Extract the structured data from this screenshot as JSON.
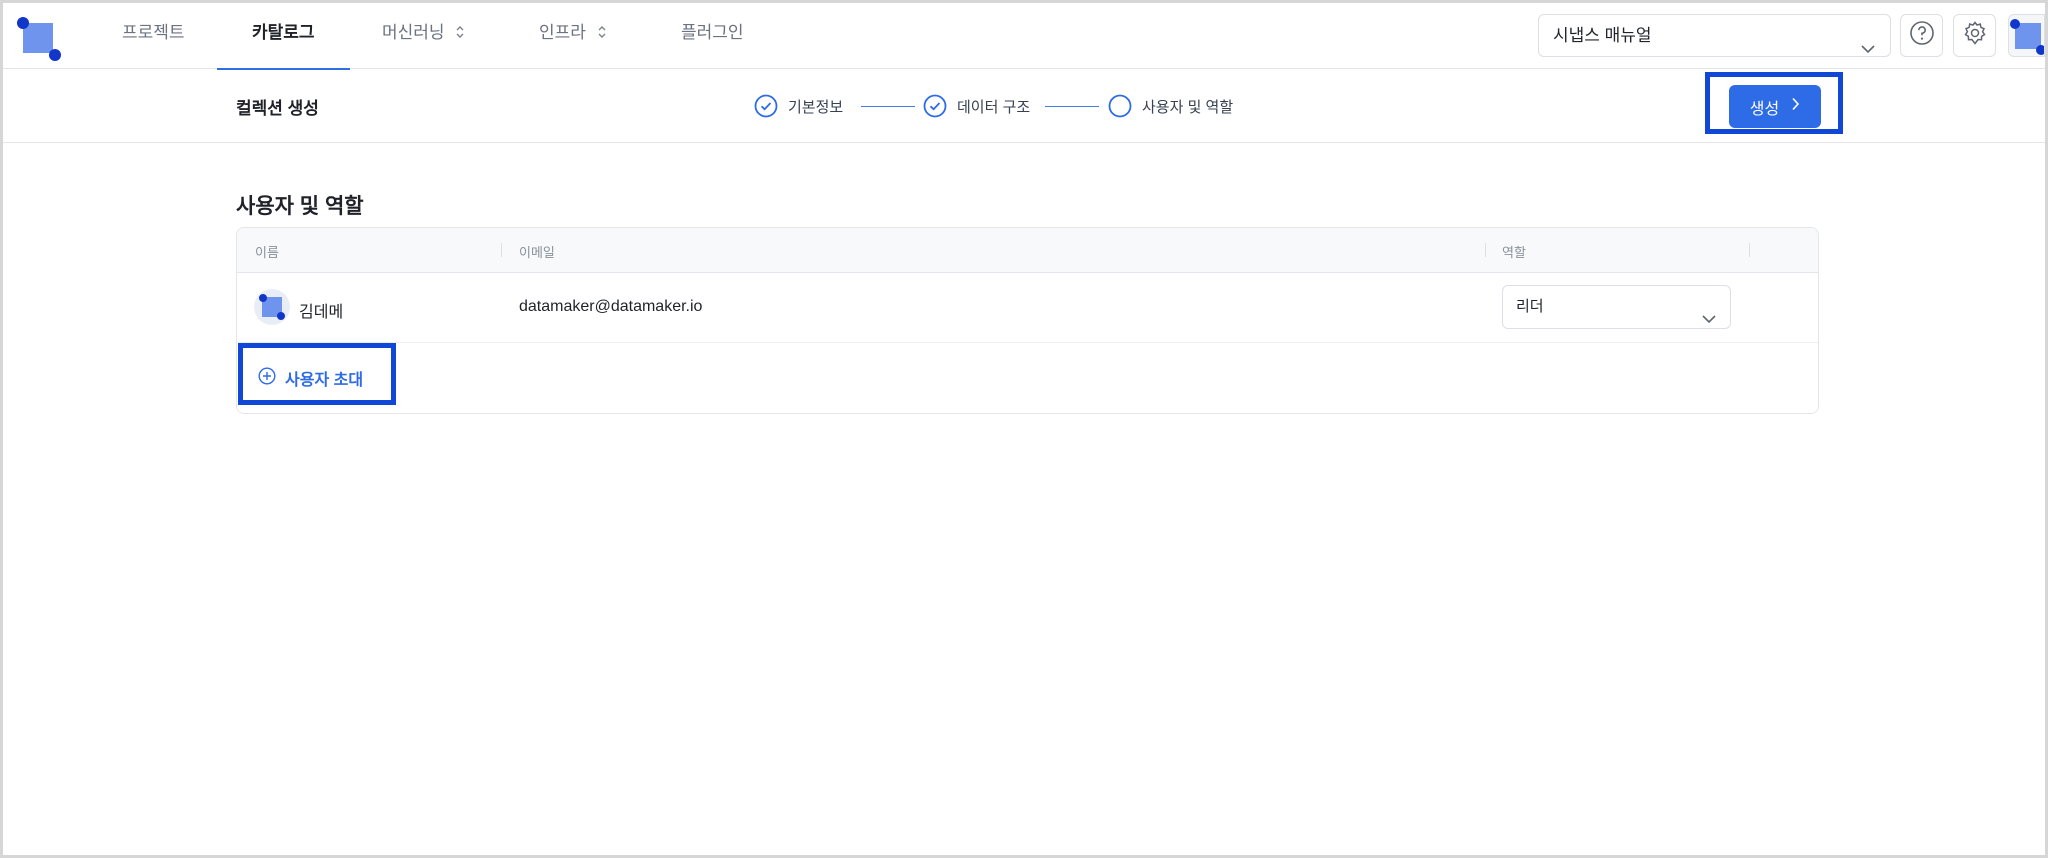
{
  "nav": {
    "items": [
      {
        "label": "프로젝트",
        "active": false,
        "has_caret": false
      },
      {
        "label": "카탈로그",
        "active": true,
        "has_caret": false
      },
      {
        "label": "머신러닝",
        "active": false,
        "has_caret": true
      },
      {
        "label": "인프라",
        "active": false,
        "has_caret": true
      },
      {
        "label": "플러그인",
        "active": false,
        "has_caret": false
      }
    ],
    "manual_select": {
      "value": "시냅스 매뉴얼",
      "icon": "chevron-down-icon"
    },
    "help_icon": "help-circle-icon",
    "settings_icon": "gear-icon"
  },
  "stepbar": {
    "title": "컬렉션 생성",
    "steps": [
      {
        "label": "기본정보",
        "status": "done"
      },
      {
        "label": "데이터 구조",
        "status": "done"
      },
      {
        "label": "사용자 및 역할",
        "status": "current"
      }
    ],
    "create_button": {
      "label": "생성",
      "icon": "chevron-right-icon"
    }
  },
  "section": {
    "title": "사용자 및 역할",
    "columns": [
      "이름",
      "이메일",
      "역할"
    ],
    "rows": [
      {
        "name": "김데메",
        "email": "datamaker@datamaker.io",
        "role": "리더"
      }
    ],
    "invite_label": "사용자 초대"
  },
  "colors": {
    "accent": "#2e6be6",
    "highlight": "#1147d6",
    "logo": "#6f94ee",
    "logo_dot": "#1136c9"
  }
}
